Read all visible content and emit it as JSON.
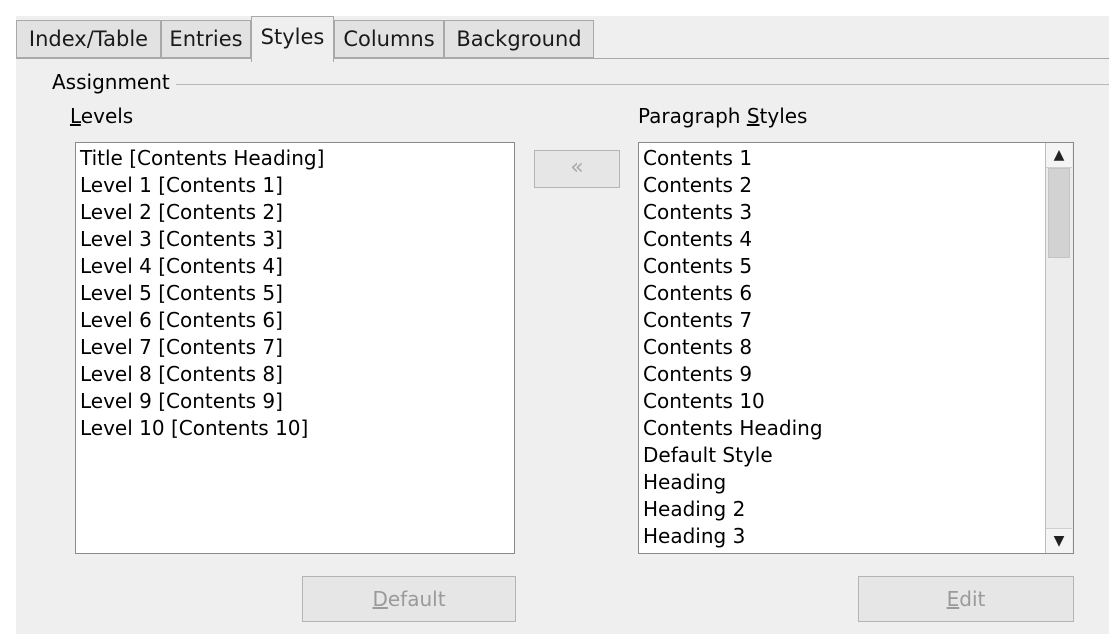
{
  "tabs": [
    {
      "label": "Index/Table",
      "active": false
    },
    {
      "label": "Entries",
      "active": false
    },
    {
      "label": "Styles",
      "active": true
    },
    {
      "label": "Columns",
      "active": false
    },
    {
      "label": "Background",
      "active": false
    }
  ],
  "assignment": {
    "group_label": "Assignment",
    "levels_label_mnemonic": "L",
    "levels_label_rest": "evels",
    "styles_label_pre": "Paragraph ",
    "styles_label_mnemonic": "S",
    "styles_label_rest": "tyles",
    "assign_button_label": "«",
    "levels": [
      "Title [Contents Heading]",
      "Level 1 [Contents 1]",
      "Level 2 [Contents 2]",
      "Level 3 [Contents 3]",
      "Level 4 [Contents 4]",
      "Level 5 [Contents 5]",
      "Level 6 [Contents 6]",
      "Level 7 [Contents 7]",
      "Level 8 [Contents 8]",
      "Level 9 [Contents 9]",
      "Level 10 [Contents 10]"
    ],
    "paragraph_styles": [
      "Contents 1",
      "Contents 2",
      "Contents 3",
      "Contents 4",
      "Contents 5",
      "Contents 6",
      "Contents 7",
      "Contents 8",
      "Contents 9",
      "Contents 10",
      "Contents Heading",
      "Default Style",
      "Heading",
      "Heading 2",
      "Heading 3"
    ],
    "default_button_mnemonic": "D",
    "default_button_rest": "efault",
    "edit_button_mnemonic": "E",
    "edit_button_rest": "dit"
  },
  "scrollbar": {
    "up_icon": "triangle-up-icon",
    "down_icon": "triangle-down-icon",
    "position_fraction": 0.0,
    "visible_fraction": 0.25
  }
}
